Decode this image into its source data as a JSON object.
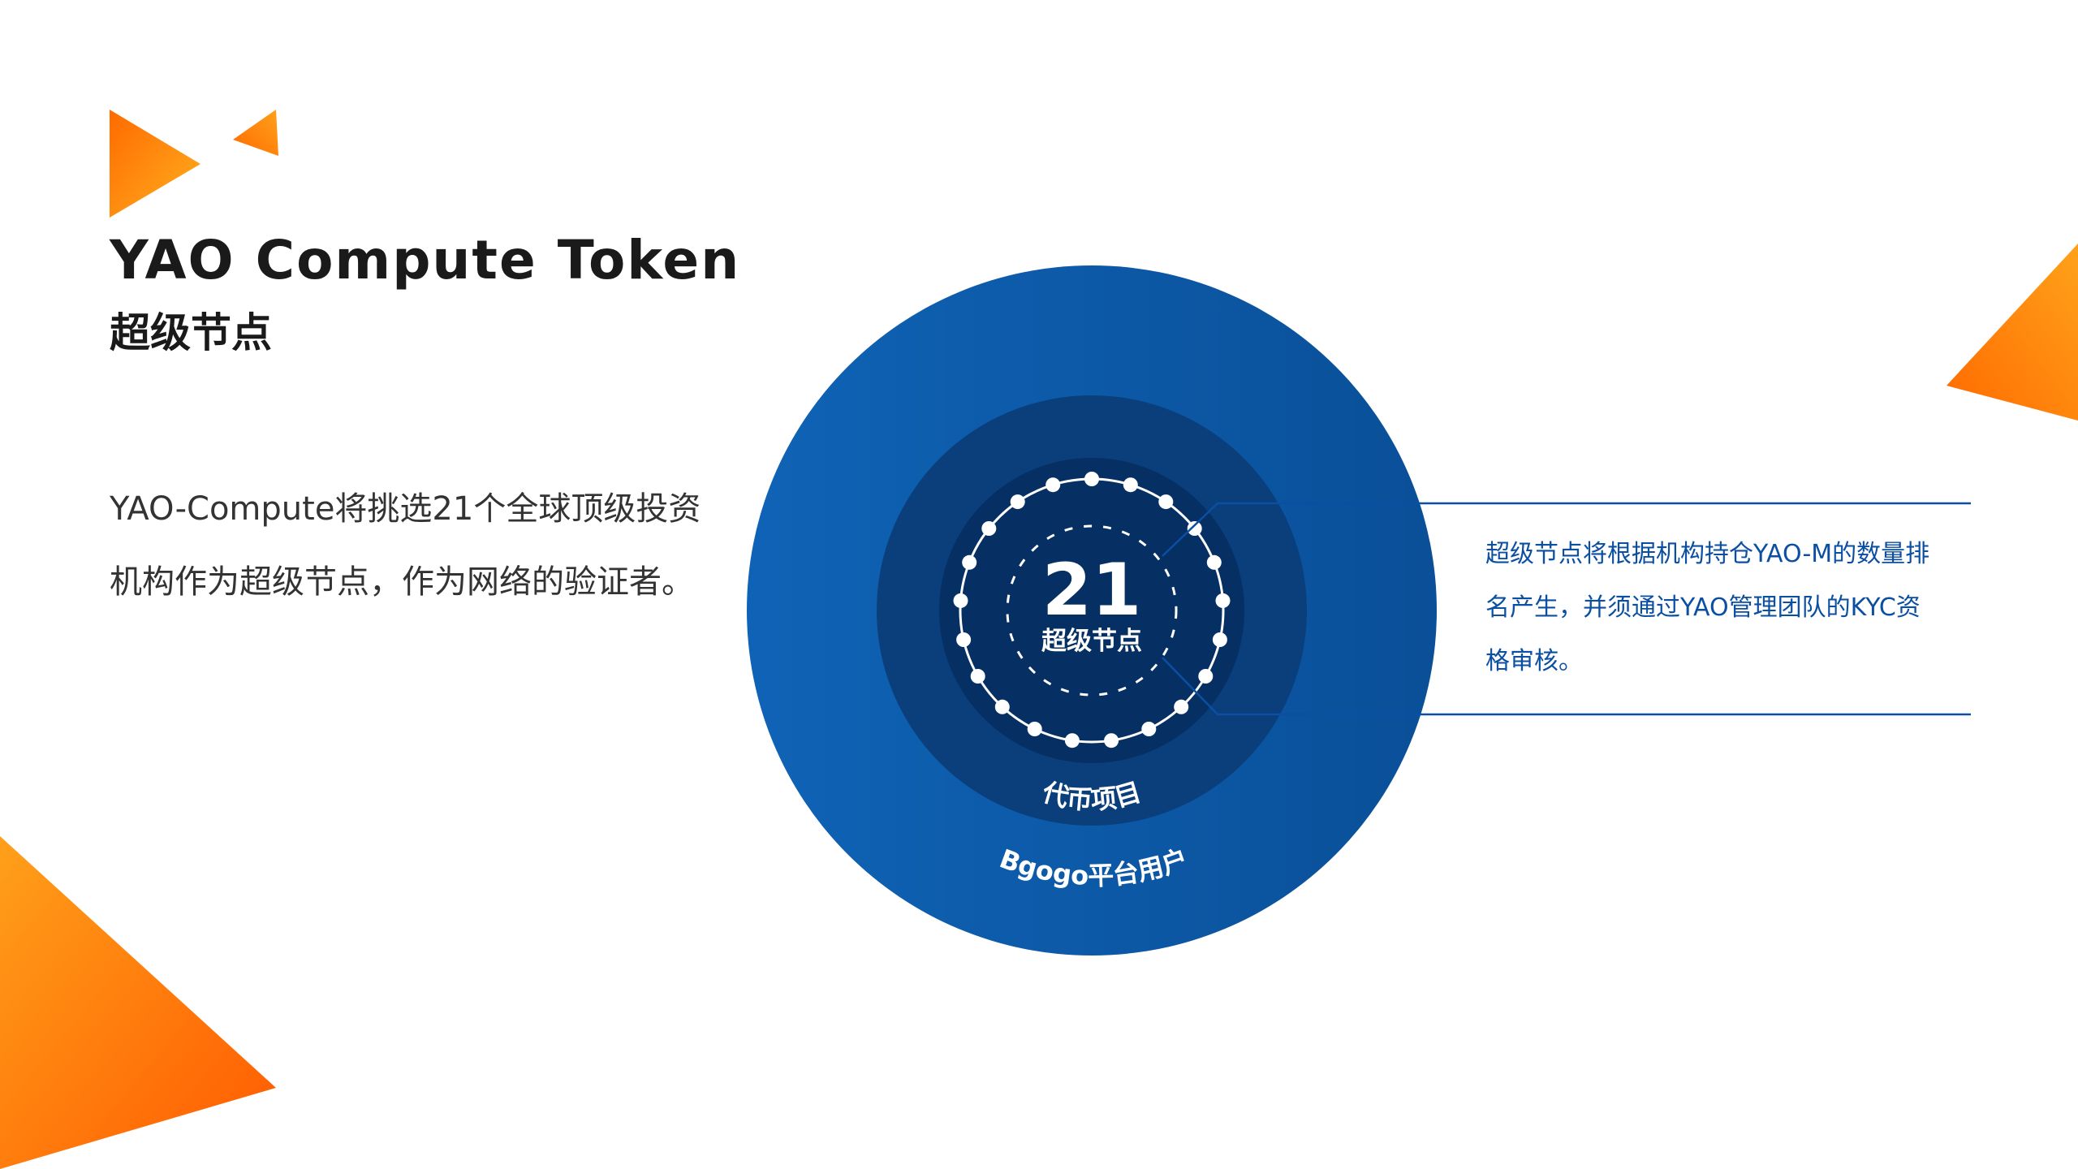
{
  "header": {
    "title": "YAO Compute Token",
    "subtitle": "超级节点"
  },
  "description": "YAO-Compute将挑选21个全球顶级投资机构作为超级节点，作为网络的验证者。",
  "diagram": {
    "core_number": "21",
    "core_label": "超级节点",
    "middle_ring_label": "代币项目",
    "outer_ring_label": "Bgogo平台用户",
    "node_count": 21
  },
  "callout": {
    "text": "超级节点将根据机构持仓YAO-M的数量排名产生，并须通过YAO管理团队的KYC资格审核。"
  },
  "colors": {
    "accent_orange": "#ff7a00",
    "accent_yellow": "#ffa31a",
    "outer_blue": "#0d5fb0",
    "middle_blue": "#0a3f7c",
    "core_blue": "#062f63",
    "callout_text": "#0b4fa2"
  }
}
